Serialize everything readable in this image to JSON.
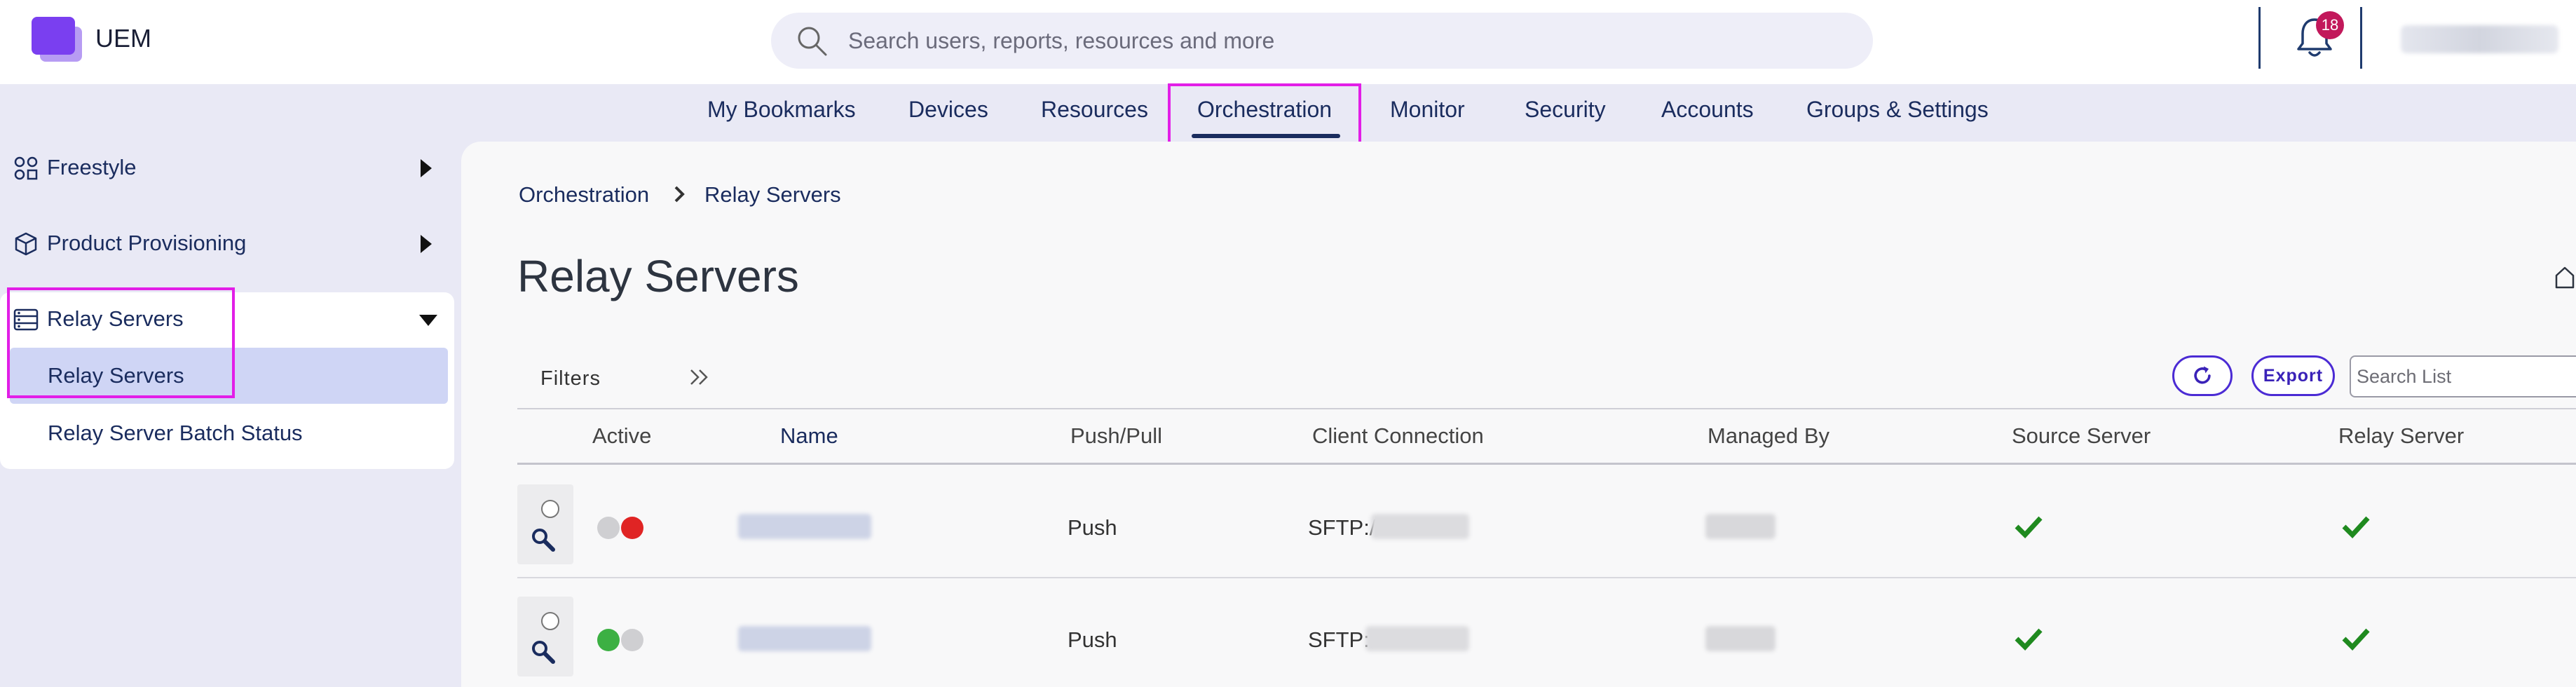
{
  "app": {
    "name": "UEM"
  },
  "search": {
    "placeholder": "Search users, reports, resources and more"
  },
  "notifications": {
    "count": "18"
  },
  "nav": {
    "items": [
      {
        "label": "My Bookmarks"
      },
      {
        "label": "Devices"
      },
      {
        "label": "Resources"
      },
      {
        "label": "Orchestration",
        "active": true
      },
      {
        "label": "Monitor"
      },
      {
        "label": "Security"
      },
      {
        "label": "Accounts"
      },
      {
        "label": "Groups & Settings"
      }
    ]
  },
  "sidebar": {
    "items": [
      {
        "label": "Freestyle",
        "icon": "freestyle-icon",
        "expanded": false
      },
      {
        "label": "Product Provisioning",
        "icon": "box-icon",
        "expanded": false
      },
      {
        "label": "Relay Servers",
        "icon": "server-icon",
        "expanded": true
      }
    ],
    "sub_items": [
      {
        "label": "Relay Servers",
        "selected": true
      },
      {
        "label": "Relay Server Batch Status",
        "selected": false
      }
    ]
  },
  "breadcrumb": [
    "Orchestration",
    "Relay Servers"
  ],
  "page": {
    "title": "Relay Servers"
  },
  "toolbar": {
    "filters_label": "Filters",
    "export_label": "Export",
    "search_placeholder": "Search List"
  },
  "table": {
    "columns": [
      "Active",
      "Name",
      "Push/Pull",
      "Client Connection",
      "Managed By",
      "Source Server",
      "Relay Server"
    ],
    "sorted_column": "Name",
    "rows": [
      {
        "active_state": "inactive",
        "push_pull": "Push",
        "client_connection_prefix": "SFTP:/",
        "source_server": true,
        "relay_server": true
      },
      {
        "active_state": "active",
        "push_pull": "Push",
        "client_connection_prefix": "SFTP:",
        "source_server": true,
        "relay_server": true
      }
    ]
  },
  "colors": {
    "brand": "#7a3ff0",
    "nav_text": "#1a2c5e",
    "highlight": "#e21ee7",
    "badge": "#c2185b",
    "status_red": "#e02424",
    "status_green": "#3cb043",
    "check_green": "#1f8a1f",
    "button_border": "#4b2bd4"
  }
}
